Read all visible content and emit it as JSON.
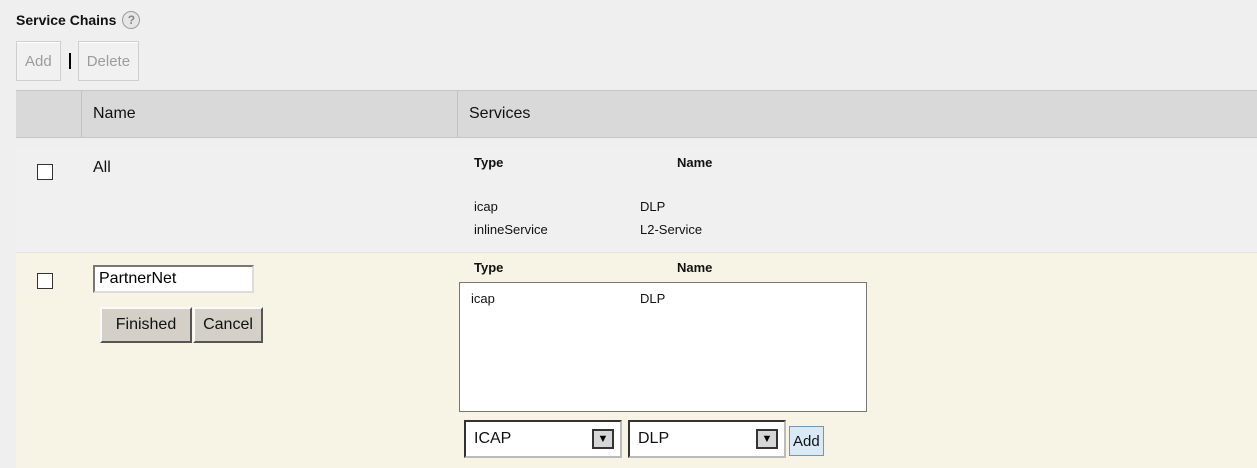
{
  "title": "Service Chains",
  "help_icon": "question-mark-icon",
  "toolbar": {
    "add_label": "Add",
    "delete_label": "Delete"
  },
  "table": {
    "headers": {
      "name": "Name",
      "services": "Services"
    },
    "rows": [
      {
        "name": "All",
        "services_headers": {
          "type": "Type",
          "name": "Name"
        },
        "services": [
          {
            "type": "icap",
            "name": "DLP"
          },
          {
            "type": "inlineService",
            "name": "L2-Service"
          }
        ]
      },
      {
        "name_input_value": "PartnerNet",
        "finished_label": "Finished",
        "cancel_label": "Cancel",
        "services_headers": {
          "type": "Type",
          "name": "Name"
        },
        "services": [
          {
            "type": "icap",
            "name": "DLP"
          }
        ],
        "type_select": "ICAP",
        "name_select": "DLP",
        "add_label": "Add"
      }
    ]
  },
  "colors": {
    "edit_row_bg": "#f8f4e5",
    "header_bg": "#d9d9d9",
    "accent_add": "#d9e9f6"
  }
}
